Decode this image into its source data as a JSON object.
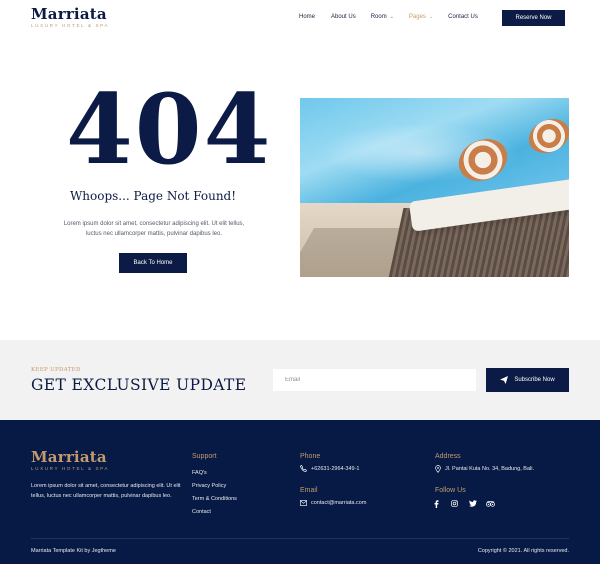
{
  "brand": {
    "name": "Marriata",
    "tagline": "LUXURY HOTEL & SPA",
    "brand_color": "#0c1b45",
    "accent_color": "#c49a6c"
  },
  "nav": {
    "items": [
      {
        "label": "Home",
        "dropdown": false,
        "active": false
      },
      {
        "label": "About Us",
        "dropdown": false,
        "active": false
      },
      {
        "label": "Room",
        "dropdown": true,
        "active": false
      },
      {
        "label": "Pages",
        "dropdown": true,
        "active": true
      },
      {
        "label": "Contact Us",
        "dropdown": false,
        "active": false
      }
    ],
    "cta_label": "Reserve Now"
  },
  "error_page": {
    "code": "404",
    "title": "Whoops... Page Not Found!",
    "text_line1": "Lorem ipsum dolor sit amet, consectetur adipiscing elit. Ut elit tellus,",
    "text_line2": "luctus nec ullamcorper mattis, pulvinar dapibus leo.",
    "button_label": "Back To Home",
    "image_icon": "pool-lounger-photo"
  },
  "newsletter": {
    "kicker": "KEEP UPDATED",
    "title": "GET EXCLUSIVE UPDATE",
    "email_placeholder": "Email",
    "button_label": "Subscribe Now",
    "button_icon": "paper-plane-icon"
  },
  "footer": {
    "about": "Lorem ipsum dolor sit amet, consectetur adipiscing elit. Ut elit tellus, luctus nec ullamcorper mattis, pulvinar dapibus leo.",
    "support_title": "Support",
    "support_links": [
      "FAQ's",
      "Privacy Policy",
      "Term & Conditions",
      "Contact"
    ],
    "phone_title": "Phone",
    "phone": "+62631-2964-349-1",
    "email_title": "Email",
    "email": "contact@marriata.com",
    "address_title": "Address",
    "address": "Jl. Pantai Kuta No. 34, Badung, Bali.",
    "follow_title": "Follow Us",
    "social_icons": [
      "facebook-icon",
      "instagram-icon",
      "twitter-icon",
      "tripadvisor-icon"
    ],
    "bottom_left": "Marriata Template Kit by Jegtheme",
    "bottom_right": "Copyright © 2021. All rights reserved."
  }
}
